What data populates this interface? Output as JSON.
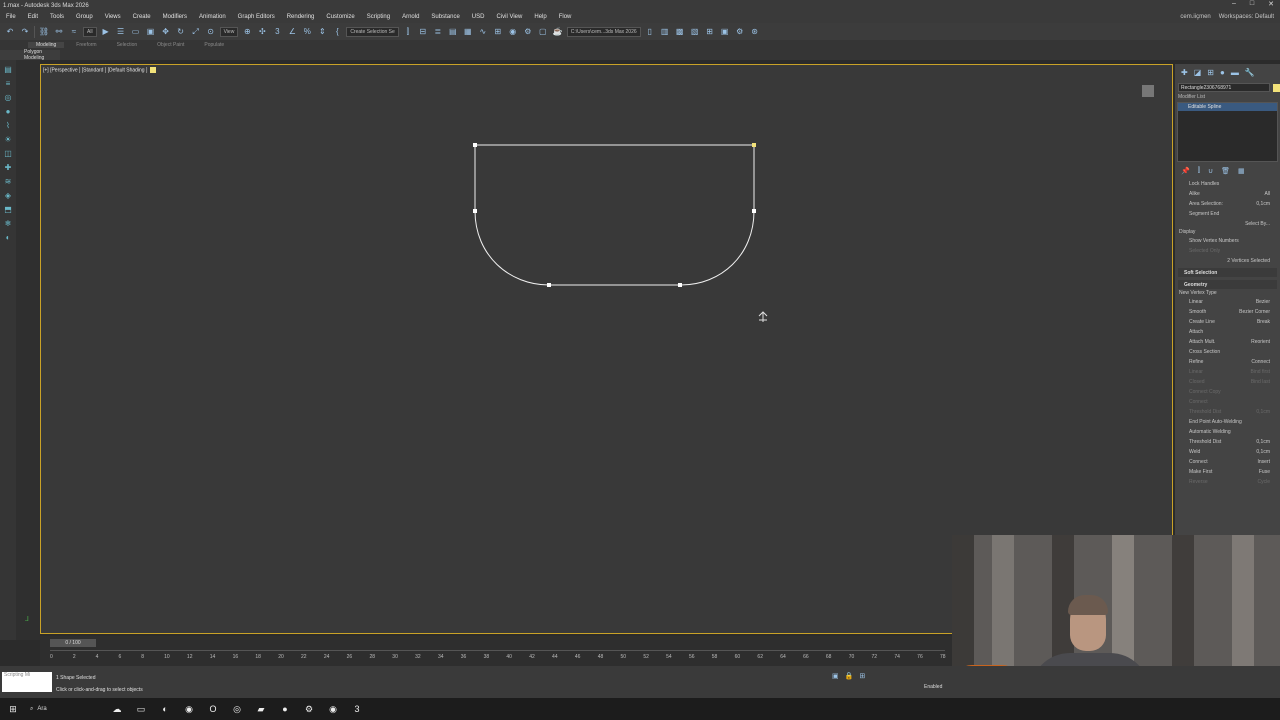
{
  "title": "1.max - Autodesk 3ds Max 2026",
  "menu": [
    "File",
    "Edit",
    "Tools",
    "Group",
    "Views",
    "Create",
    "Modifiers",
    "Animation",
    "Graph Editors",
    "Rendering",
    "Customize",
    "Scripting",
    "Arnold",
    "Substance",
    "USD",
    "Civil View",
    "Help",
    "Flow"
  ],
  "user": "cem.iiçmen",
  "workspace": "Workspaces: Default",
  "toolbar": {
    "selection_filter": "All",
    "view_dropdown": "View",
    "named_selection": "Create Selection Se",
    "project_path": "C:\\Users\\cem...3ds Max 2026"
  },
  "ribbon": {
    "tabs": [
      "Modeling",
      "Freeform",
      "Selection",
      "Object Paint",
      "Populate"
    ],
    "subtitle": "Polygon Modeling"
  },
  "viewport": {
    "label": "[+] [Perspective ] [Standard ] [Default Shading ]"
  },
  "command_panel": {
    "object_name": "Rectangle2306768971",
    "modifier_list": "Modifier List",
    "stack_item": "Editable Spline",
    "selection_rows": [
      {
        "label": "Lock Handles",
        "right": ""
      },
      {
        "label": "Alike",
        "right": "All"
      },
      {
        "label": "Area Selection:",
        "right": "0,1cm"
      },
      {
        "label": "Segment End",
        "right": ""
      },
      {
        "label": "",
        "right": "Select By..."
      }
    ],
    "display_label": "Display",
    "show_vertex_numbers": "Show Vertex Numbers",
    "selected_only": "Selected Only",
    "vertices_selected": "2 Vertices Selected",
    "soft_selection": "Soft Selection",
    "geometry": "Geometry",
    "new_vertex_type": "New Vertex Type",
    "vertex_types": [
      {
        "left": "Linear",
        "right": "Bezier"
      },
      {
        "left": "Smooth",
        "right": "Bezier Corner"
      }
    ],
    "geom_rows": [
      {
        "left": "Create Line",
        "right": "Break",
        "dim": false
      },
      {
        "left": "Attach",
        "right": "",
        "dim": false
      },
      {
        "left": "Attach Mult.",
        "right": "Reorient",
        "dim": false
      },
      {
        "left": "Cross Section",
        "right": "",
        "dim": false
      },
      {
        "left": "Refine",
        "right": "Connect",
        "dim": false
      },
      {
        "left": "Linear",
        "right": "Bind first",
        "dim": true
      },
      {
        "left": "Closed",
        "right": "Bind last",
        "dim": true
      },
      {
        "left": "Connect Copy",
        "right": "",
        "dim": true
      },
      {
        "left": "Connect",
        "right": "",
        "dim": true
      },
      {
        "left": "Threshold Dist",
        "right": "0,1cm",
        "dim": true
      },
      {
        "left": "End Point Auto-Welding",
        "right": "",
        "dim": false
      },
      {
        "left": "Automatic Welding",
        "right": "",
        "dim": false
      },
      {
        "left": "Threshold Dist",
        "right": "0,1cm",
        "dim": false
      },
      {
        "left": "Weld",
        "right": "0,1cm",
        "dim": false
      },
      {
        "left": "Connect",
        "right": "Insert",
        "dim": false
      },
      {
        "left": "Make First",
        "right": "Fuse",
        "dim": false
      },
      {
        "left": "Reverse",
        "right": "Cycle",
        "dim": true
      }
    ]
  },
  "timeline": {
    "frame": "0 / 100",
    "ticks": [
      "0",
      "2",
      "4",
      "6",
      "8",
      "10",
      "12",
      "14",
      "16",
      "18",
      "20",
      "22",
      "24",
      "26",
      "28",
      "30",
      "32",
      "34",
      "36",
      "38",
      "40",
      "42",
      "44",
      "46",
      "48",
      "50",
      "52",
      "54",
      "56",
      "58",
      "60",
      "62",
      "64",
      "66",
      "68",
      "70",
      "72",
      "74",
      "76",
      "78"
    ]
  },
  "status": {
    "line1": "1 Shape Selected",
    "line2": "Click or click-and-drag to select objects",
    "maxscript": "Scripting Mi",
    "enabled": "Enabled"
  },
  "taskbar": {
    "search": "Ara"
  },
  "colors": {
    "viewport_border": "#c9a227",
    "selected_vertex": "#f2e27a",
    "accent": "#9cc3e6"
  }
}
